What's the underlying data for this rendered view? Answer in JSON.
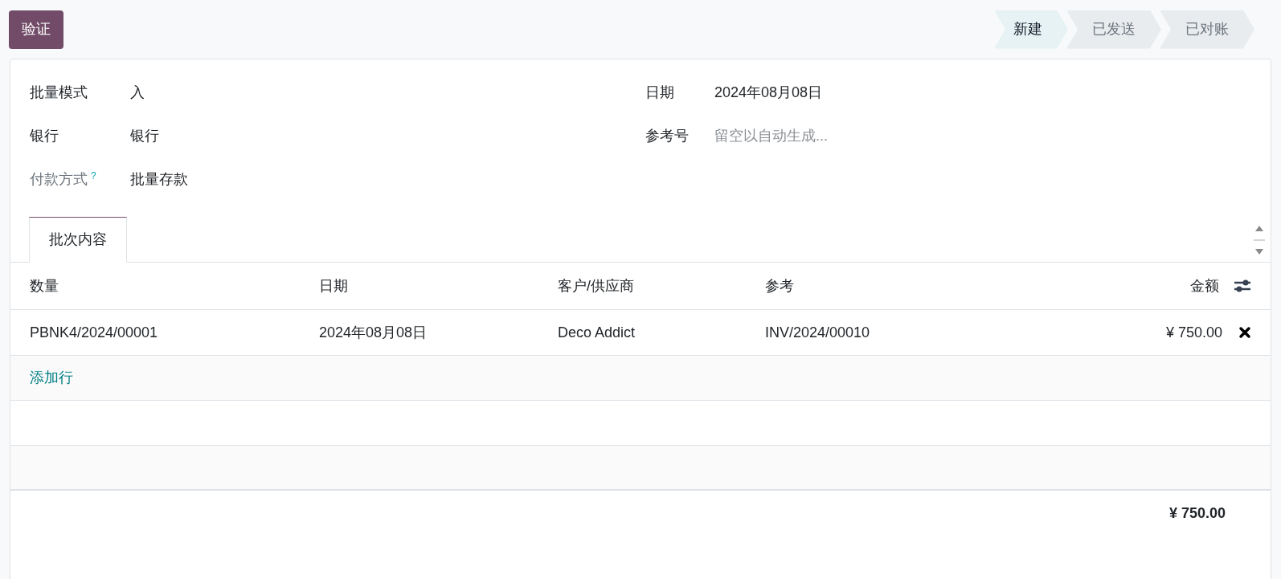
{
  "validate_button": "验证",
  "stages": [
    {
      "label": "新建",
      "selected": true
    },
    {
      "label": "已发送",
      "selected": false
    },
    {
      "label": "已对账",
      "selected": false
    }
  ],
  "left_fields": [
    {
      "label": "批量模式",
      "value": "入",
      "muted": false
    },
    {
      "label": "银行",
      "value": "银行",
      "muted": false
    },
    {
      "label": "付款方式",
      "help": "?",
      "value": "批量存款",
      "muted": true
    }
  ],
  "right_fields": [
    {
      "label": "日期",
      "value": "2024年08月08日"
    },
    {
      "label": "参考号",
      "placeholder": "留空以自动生成..."
    }
  ],
  "tabs": [
    {
      "label": "批次内容",
      "selected": true
    }
  ],
  "table": {
    "columns": [
      "数量",
      "日期",
      "客户/供应商",
      "参考",
      "金额"
    ],
    "rows": [
      [
        "PBNK4/2024/00001",
        "2024年08月08日",
        "Deco Addict",
        "INV/2024/00010",
        "¥ 750.00"
      ]
    ],
    "add_line": "添加行",
    "total": "¥ 750.00"
  }
}
